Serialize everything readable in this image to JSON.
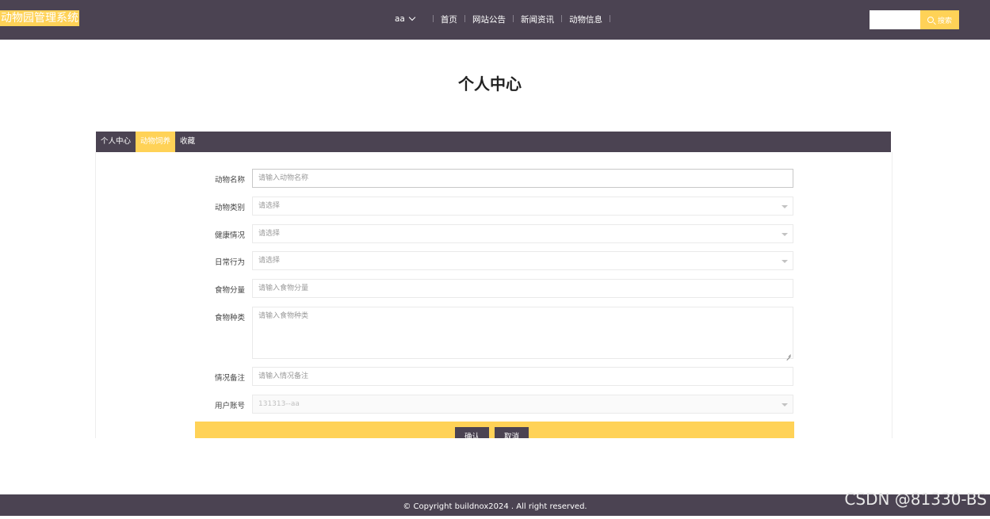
{
  "header": {
    "logo": "动物园管理系统",
    "user": "aa",
    "nav": [
      "首页",
      "网站公告",
      "新闻资讯",
      "动物信息"
    ],
    "search_placeholder": "",
    "search_button": "搜索"
  },
  "page_title": "个人中心",
  "tabs": [
    {
      "label": "个人中心",
      "active": false
    },
    {
      "label": "动物饲养",
      "active": true
    },
    {
      "label": "收藏",
      "active": false
    }
  ],
  "form": {
    "fields": [
      {
        "label": "动物名称",
        "placeholder": "请输入动物名称",
        "type": "input"
      },
      {
        "label": "动物类别",
        "placeholder": "请选择",
        "type": "select"
      },
      {
        "label": "健康情况",
        "placeholder": "请选择",
        "type": "select"
      },
      {
        "label": "日常行为",
        "placeholder": "请选择",
        "type": "select"
      },
      {
        "label": "食物分量",
        "placeholder": "请输入食物分量",
        "type": "input"
      },
      {
        "label": "食物种类",
        "placeholder": "请输入食物种类",
        "type": "textarea"
      },
      {
        "label": "情况备注",
        "placeholder": "请输入情况备注",
        "type": "input"
      },
      {
        "label": "用户账号",
        "value": "131313--aa",
        "type": "select-disabled"
      }
    ],
    "confirm": "确认",
    "cancel": "取消"
  },
  "footer": "© Copyright buildnox2024 . All right reserved.",
  "watermark": "CSDN @81330-BS"
}
